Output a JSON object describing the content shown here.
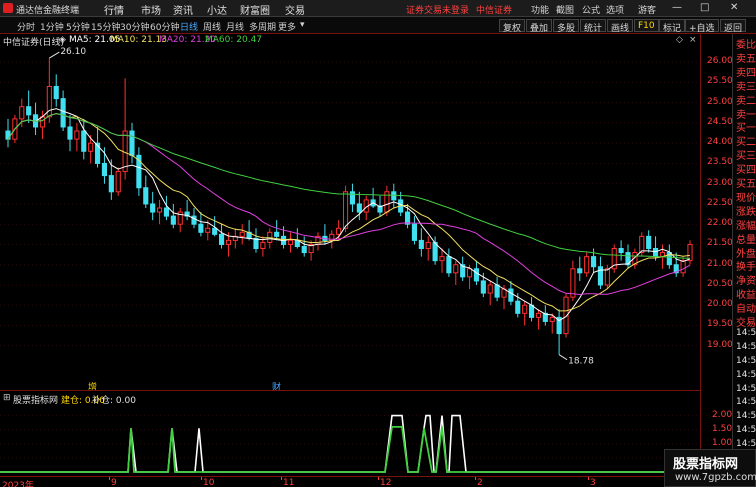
{
  "menubar": {
    "app_name": "通达信金融终端",
    "menus": [
      "行情",
      "市场",
      "资讯",
      "小达",
      "财富圈",
      "交易"
    ],
    "login_status": "证券交易未登录",
    "broker": "中信证券",
    "tools": [
      "功能",
      "截图",
      "公式",
      "选项"
    ],
    "guest": "游客"
  },
  "toolbar": {
    "periods": [
      "分时",
      "1分钟",
      "5分钟",
      "15分钟",
      "30分钟",
      "60分钟",
      "日线",
      "周线",
      "月线",
      "多周期",
      "更多"
    ],
    "active_period": "日线",
    "right_buttons": [
      "复权",
      "叠加",
      "多股",
      "统计",
      "画线",
      "F10",
      "标记",
      "+自选",
      "返回"
    ]
  },
  "info": {
    "stock": "中信证券(日线)",
    "ma5_label": "MA5: 21.05",
    "ma10_label": "MA10: 21.13",
    "ma20_label": "MA20: 21.20",
    "ma60_label": "MA60: 20.47"
  },
  "colors": {
    "up": "#ff3030",
    "down": "#40e0f0",
    "ma5": "#ffffff",
    "ma10": "#f0e060",
    "ma20": "#e040e0",
    "ma60": "#40d040",
    "axis": "#ff4040"
  },
  "annotations": {
    "high_label": "26.10",
    "low_label": "18.78",
    "event_1": "增",
    "event_2": "财"
  },
  "yaxis_ticks": [
    "26.00",
    "25.50",
    "25.00",
    "24.50",
    "24.00",
    "23.50",
    "23.00",
    "22.50",
    "22.00",
    "21.50",
    "21.00",
    "20.50",
    "20.00",
    "19.50",
    "19.00"
  ],
  "right_panel": [
    "委比",
    "卖五",
    "卖四",
    "卖三",
    "卖二",
    "卖一",
    "买一",
    "买二",
    "买三",
    "买四",
    "买五",
    "现价",
    "涨跌",
    "涨幅",
    "总量",
    "外盘",
    "换手",
    "净资",
    "收益",
    "自动",
    "交易",
    "14:5",
    "14:5",
    "14:5",
    "14:5",
    "14:5",
    "14:5",
    "14:5",
    "14:5",
    "14:5",
    "14:5"
  ],
  "sub": {
    "title": "股票指标网",
    "buy_label": "建仓: 0.00",
    "add_label": "补仓: 0.00",
    "ticks": [
      "2.00",
      "1.50",
      "1.00",
      "0.50",
      "0.00"
    ]
  },
  "xaxis": {
    "labels": [
      "2023年",
      "9",
      "10",
      "11",
      "12",
      "2",
      "3"
    ]
  },
  "watermark": {
    "line1": "股票指标网",
    "line2": "www.7gpzb.com"
  },
  "chart_data": {
    "type": "candlestick",
    "title": "中信证券(日线)",
    "ylim": [
      18.5,
      26.3
    ],
    "sub_ylim": [
      0,
      2.2
    ],
    "candles": [
      [
        24.3,
        24.6,
        23.9,
        24.1
      ],
      [
        24.1,
        24.7,
        24.0,
        24.6
      ],
      [
        24.6,
        25.1,
        24.4,
        24.9
      ],
      [
        24.9,
        25.3,
        24.5,
        24.7
      ],
      [
        24.7,
        25.0,
        24.2,
        24.4
      ],
      [
        24.4,
        24.8,
        24.1,
        24.65
      ],
      [
        24.65,
        26.1,
        24.5,
        25.4
      ],
      [
        25.4,
        25.7,
        24.9,
        25.1
      ],
      [
        25.1,
        25.3,
        24.3,
        24.4
      ],
      [
        24.4,
        24.7,
        23.8,
        24.1
      ],
      [
        24.1,
        24.5,
        23.8,
        24.3
      ],
      [
        24.3,
        24.6,
        23.6,
        23.8
      ],
      [
        23.8,
        24.2,
        23.5,
        24.0
      ],
      [
        24.0,
        24.4,
        23.4,
        23.5
      ],
      [
        23.5,
        23.9,
        23.0,
        23.2
      ],
      [
        23.2,
        23.6,
        22.6,
        22.8
      ],
      [
        22.8,
        23.4,
        22.7,
        23.3
      ],
      [
        23.3,
        25.6,
        23.1,
        24.3
      ],
      [
        24.3,
        24.5,
        23.5,
        23.7
      ],
      [
        23.7,
        23.9,
        22.7,
        22.9
      ],
      [
        22.9,
        23.2,
        22.4,
        22.5
      ],
      [
        22.5,
        22.8,
        22.1,
        22.3
      ],
      [
        22.3,
        22.6,
        22.0,
        22.4
      ],
      [
        22.4,
        22.7,
        22.1,
        22.2
      ],
      [
        22.2,
        22.5,
        21.9,
        22.0
      ],
      [
        22.0,
        22.4,
        21.8,
        22.3
      ],
      [
        22.3,
        22.6,
        22.1,
        22.2
      ],
      [
        22.2,
        22.4,
        21.9,
        22.0
      ],
      [
        22.0,
        22.3,
        21.7,
        21.8
      ],
      [
        21.8,
        22.1,
        21.6,
        21.9
      ],
      [
        21.9,
        22.2,
        21.7,
        21.75
      ],
      [
        21.75,
        22.0,
        21.4,
        21.5
      ],
      [
        21.5,
        21.8,
        21.2,
        21.6
      ],
      [
        21.6,
        21.9,
        21.4,
        21.7
      ],
      [
        21.7,
        22.0,
        21.5,
        21.8
      ],
      [
        21.8,
        22.1,
        21.6,
        21.65
      ],
      [
        21.65,
        21.9,
        21.3,
        21.4
      ],
      [
        21.4,
        21.7,
        21.2,
        21.55
      ],
      [
        21.55,
        21.9,
        21.4,
        21.8
      ],
      [
        21.8,
        22.1,
        21.6,
        21.7
      ],
      [
        21.7,
        21.95,
        21.4,
        21.5
      ],
      [
        21.5,
        21.8,
        21.3,
        21.6
      ],
      [
        21.6,
        21.9,
        21.4,
        21.45
      ],
      [
        21.45,
        21.7,
        21.2,
        21.3
      ],
      [
        21.3,
        21.6,
        21.1,
        21.5
      ],
      [
        21.5,
        21.8,
        21.35,
        21.7
      ],
      [
        21.7,
        22.0,
        21.5,
        21.6
      ],
      [
        21.6,
        21.85,
        21.4,
        21.75
      ],
      [
        21.75,
        22.1,
        21.6,
        21.9
      ],
      [
        21.9,
        22.95,
        21.8,
        22.8
      ],
      [
        22.8,
        23.0,
        22.3,
        22.5
      ],
      [
        22.5,
        22.8,
        22.1,
        22.3
      ],
      [
        22.3,
        22.7,
        22.1,
        22.6
      ],
      [
        22.6,
        22.9,
        22.4,
        22.45
      ],
      [
        22.45,
        22.7,
        22.2,
        22.3
      ],
      [
        22.3,
        22.95,
        22.2,
        22.8
      ],
      [
        22.8,
        23.0,
        22.4,
        22.6
      ],
      [
        22.6,
        22.8,
        22.2,
        22.3
      ],
      [
        22.3,
        22.5,
        21.9,
        22.0
      ],
      [
        22.0,
        22.2,
        21.5,
        21.6
      ],
      [
        21.6,
        21.9,
        21.2,
        21.4
      ],
      [
        21.4,
        21.7,
        21.1,
        21.55
      ],
      [
        21.55,
        21.7,
        21.0,
        21.1
      ],
      [
        21.1,
        21.4,
        20.8,
        21.2
      ],
      [
        21.2,
        21.4,
        20.7,
        20.8
      ],
      [
        20.8,
        21.1,
        20.5,
        21.0
      ],
      [
        21.0,
        21.2,
        20.6,
        20.7
      ],
      [
        20.7,
        21.0,
        20.4,
        20.9
      ],
      [
        20.9,
        21.1,
        20.5,
        20.6
      ],
      [
        20.6,
        20.8,
        20.2,
        20.3
      ],
      [
        20.3,
        20.6,
        20.0,
        20.5
      ],
      [
        20.5,
        20.7,
        20.1,
        20.2
      ],
      [
        20.2,
        20.5,
        19.9,
        20.4
      ],
      [
        20.4,
        20.6,
        20.0,
        20.1
      ],
      [
        20.1,
        20.3,
        19.7,
        19.8
      ],
      [
        19.8,
        20.1,
        19.5,
        20.0
      ],
      [
        20.0,
        20.2,
        19.6,
        19.7
      ],
      [
        19.7,
        19.9,
        19.4,
        19.8
      ],
      [
        19.8,
        20.0,
        19.5,
        19.6
      ],
      [
        19.6,
        19.8,
        19.3,
        19.7
      ],
      [
        19.7,
        19.9,
        18.78,
        19.3
      ],
      [
        19.3,
        20.3,
        19.2,
        20.2
      ],
      [
        20.2,
        21.1,
        20.1,
        20.9
      ],
      [
        20.9,
        21.2,
        20.6,
        20.8
      ],
      [
        20.8,
        21.3,
        20.7,
        21.2
      ],
      [
        21.2,
        21.4,
        20.8,
        20.95
      ],
      [
        20.95,
        21.2,
        20.4,
        20.5
      ],
      [
        20.5,
        21.0,
        20.4,
        20.9
      ],
      [
        20.9,
        21.5,
        20.8,
        21.4
      ],
      [
        21.4,
        21.6,
        21.1,
        21.3
      ],
      [
        21.3,
        21.5,
        20.9,
        21.0
      ],
      [
        21.0,
        21.4,
        20.9,
        21.3
      ],
      [
        21.3,
        21.8,
        21.2,
        21.7
      ],
      [
        21.7,
        21.85,
        21.3,
        21.4
      ],
      [
        21.4,
        21.7,
        21.1,
        21.2
      ],
      [
        21.2,
        21.5,
        20.9,
        21.3
      ],
      [
        21.3,
        21.5,
        20.9,
        21.0
      ],
      [
        21.0,
        21.3,
        20.7,
        20.8
      ],
      [
        20.8,
        21.2,
        20.7,
        21.1
      ],
      [
        21.1,
        21.6,
        21.0,
        21.5
      ]
    ],
    "buy_signal": [
      0,
      0,
      0,
      0,
      0,
      0,
      0,
      0,
      0,
      0,
      0,
      0,
      0,
      0,
      0,
      0,
      0,
      0,
      0,
      0,
      0,
      0,
      0,
      0,
      0,
      0,
      0,
      0,
      0,
      0,
      0,
      0,
      0,
      0,
      0,
      0,
      0,
      0,
      0,
      0,
      0,
      0,
      0,
      0,
      0,
      0,
      0,
      0,
      0,
      0,
      0,
      0,
      0,
      0,
      0,
      0,
      0,
      0,
      0,
      0,
      0,
      0,
      0,
      0,
      0,
      0,
      0,
      0,
      0,
      0,
      0,
      0,
      0,
      0,
      0,
      0,
      0,
      0,
      0,
      0,
      0,
      0,
      0,
      0,
      0,
      0,
      0,
      0,
      0,
      0,
      0,
      0,
      0,
      0,
      0,
      0,
      0,
      0,
      0,
      0
    ],
    "sub_white": [
      [
        128,
        0
      ],
      [
        131,
        1.55
      ],
      [
        136,
        0
      ],
      [
        168,
        0
      ],
      [
        172,
        1.55
      ],
      [
        177,
        0
      ],
      [
        195,
        0
      ],
      [
        199,
        1.55
      ],
      [
        203,
        0
      ],
      [
        385,
        0
      ],
      [
        392,
        2.0
      ],
      [
        402,
        2.0
      ],
      [
        408,
        0
      ],
      [
        418,
        0
      ],
      [
        424,
        1.55
      ],
      [
        426,
        2.0
      ],
      [
        430,
        2.0
      ],
      [
        434,
        0
      ],
      [
        436,
        0
      ],
      [
        442,
        2.0
      ],
      [
        447,
        0
      ],
      [
        449,
        0
      ],
      [
        452,
        2.0
      ],
      [
        460,
        2.0
      ],
      [
        466,
        0
      ]
    ],
    "sub_green": [
      [
        128,
        0
      ],
      [
        131,
        1.55
      ],
      [
        134,
        0
      ],
      [
        168,
        0
      ],
      [
        172,
        1.55
      ],
      [
        175,
        0
      ],
      [
        385,
        0
      ],
      [
        392,
        1.6
      ],
      [
        402,
        1.6
      ],
      [
        408,
        0
      ],
      [
        418,
        0
      ],
      [
        424,
        1.55
      ],
      [
        432,
        0
      ],
      [
        436,
        0
      ],
      [
        442,
        1.6
      ],
      [
        447,
        0
      ]
    ]
  }
}
